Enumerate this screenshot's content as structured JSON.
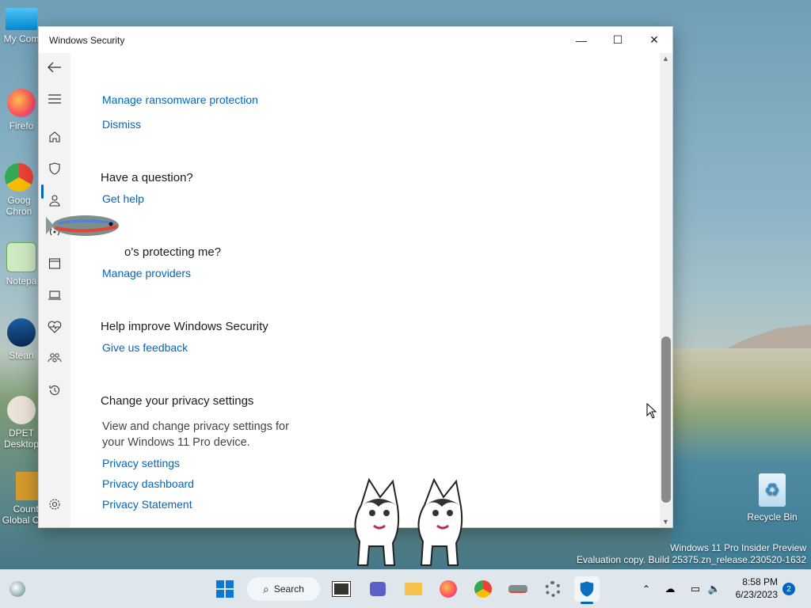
{
  "window": {
    "title": "Windows Security",
    "minimize": "—",
    "maximize": "☐",
    "close": "✕"
  },
  "content": {
    "ransomware_link": "Manage ransomware protection",
    "dismiss_link": "Dismiss",
    "question_heading": "Have a question?",
    "get_help_link": "Get help",
    "protecting_heading": "o's protecting me?",
    "manage_providers_link": "Manage providers",
    "improve_heading": "Help improve Windows Security",
    "feedback_link": "Give us feedback",
    "privacy_heading": "Change your privacy settings",
    "privacy_desc": "View and change privacy settings for your Windows 11 Pro device.",
    "privacy_settings_link": "Privacy settings",
    "privacy_dashboard_link": "Privacy dashboard",
    "privacy_statement_link": "Privacy Statement"
  },
  "nav_icons": [
    "back-icon",
    "menu-icon",
    "home-icon",
    "shield-icon",
    "account-icon",
    "network-icon",
    "app-browser-icon",
    "device-security-icon",
    "health-icon",
    "family-icon",
    "history-icon",
    "settings-icon"
  ],
  "desktop": {
    "icons": [
      {
        "label": "My Com",
        "icon": "computer-icon"
      },
      {
        "label": "Firefo",
        "icon": "firefox-icon"
      },
      {
        "label": "Goog Chron",
        "icon": "chrome-icon"
      },
      {
        "label": "Notepa",
        "icon": "notepad-icon"
      },
      {
        "label": "Stean",
        "icon": "steam-icon"
      },
      {
        "label": "DPET Desktop",
        "icon": "dpet-icon"
      },
      {
        "label": "Counter Global Offe...",
        "icon": "csgo-icon"
      }
    ],
    "recycle_bin": "Recycle Bin",
    "watermark_line1": "Windows 11 Pro Insider Preview",
    "watermark_line2": "Evaluation copy. Build 25375.zn_release.230520-1632"
  },
  "taskbar": {
    "search_label": "Search",
    "time": "8:58 PM",
    "date": "6/23/2023",
    "notification_count": "2"
  },
  "colors": {
    "accent": "#0067c0",
    "link": "#0067c0",
    "taskbar": "#dfe6ec"
  }
}
